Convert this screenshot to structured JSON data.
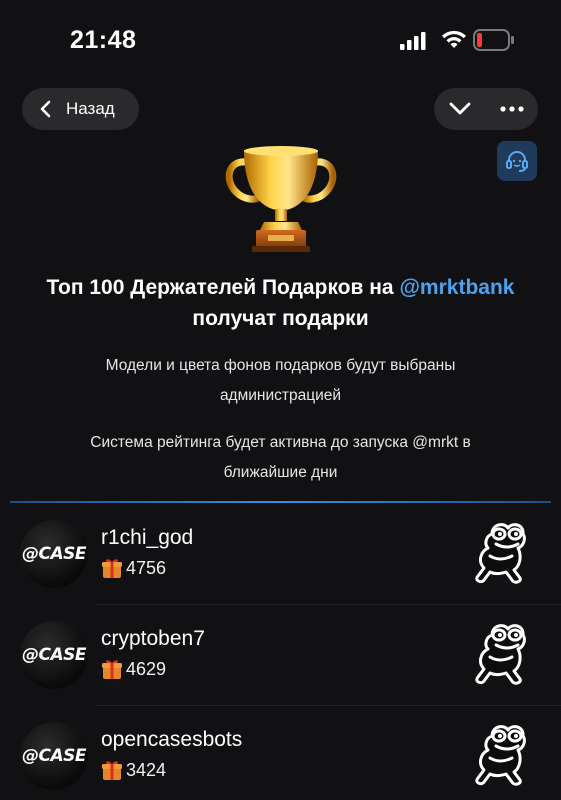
{
  "status_bar": {
    "time": "21:48"
  },
  "nav": {
    "back_label": "Назад"
  },
  "header": {
    "title_prefix": "Топ 100 Держателей Подарков на ",
    "title_mention": "@mrktbank",
    "title_suffix": "получат подарки",
    "description_1": "Модели и цвета фонов подарков будут выбраны администрацией",
    "description_2": "Система рейтинга будет активна до запуска @mrkt в ближайшие дни"
  },
  "colors": {
    "accent": "#4aa3ee",
    "background": "#111113",
    "battery_low": "#ff3b30"
  },
  "holders": [
    {
      "avatar_text": "@CASE",
      "name": "r1chi_god",
      "score": "4756"
    },
    {
      "avatar_text": "@CASE",
      "name": "cryptoben7",
      "score": "4629"
    },
    {
      "avatar_text": "@CASE",
      "name": "opencasesbots",
      "score": "3424"
    }
  ]
}
